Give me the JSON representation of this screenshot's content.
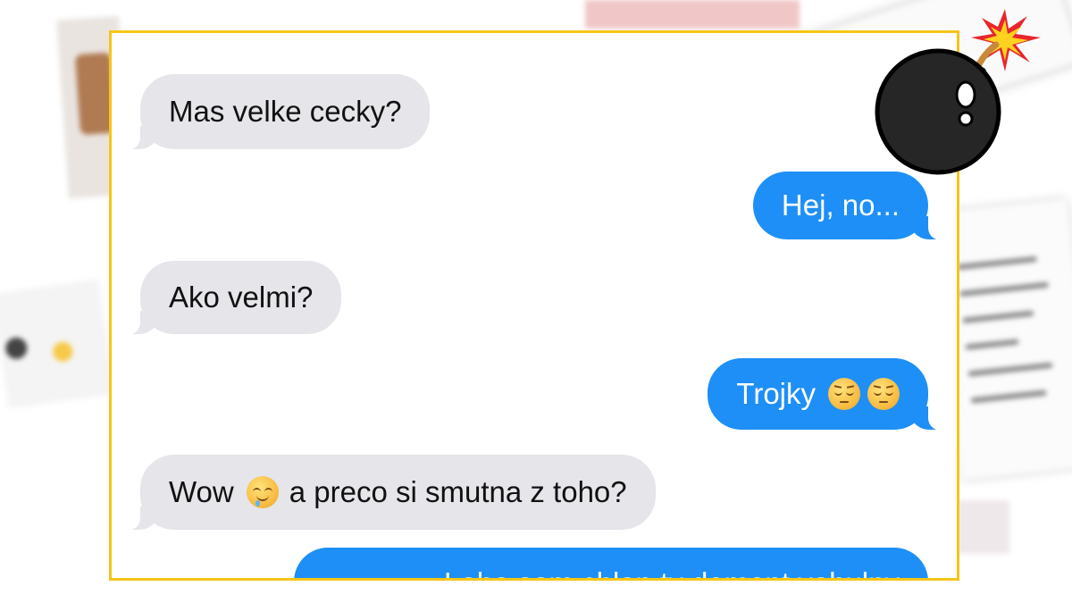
{
  "messages": [
    {
      "direction": "incoming",
      "text": "Mas velke cecky?"
    },
    {
      "direction": "outgoing",
      "text": "Hej, no..."
    },
    {
      "direction": "incoming",
      "text": "Ako velmi?"
    },
    {
      "direction": "outgoing",
      "text": "Trojky",
      "emoji": [
        "pensive-face-icon",
        "pensive-face-icon"
      ]
    },
    {
      "direction": "incoming",
      "text_before": "Wow",
      "emoji": [
        "drooling-face-icon"
      ],
      "text_after": "a preco si smutna z toho?"
    },
    {
      "direction": "outgoing",
      "text": "Loho som chlap ty dement vohulny"
    }
  ],
  "colors": {
    "frame_border": "#f5c518",
    "incoming_bubble": "#e5e5ea",
    "outgoing_bubble": "#1e8ff6"
  },
  "decoration": {
    "icon": "bomb-icon"
  }
}
